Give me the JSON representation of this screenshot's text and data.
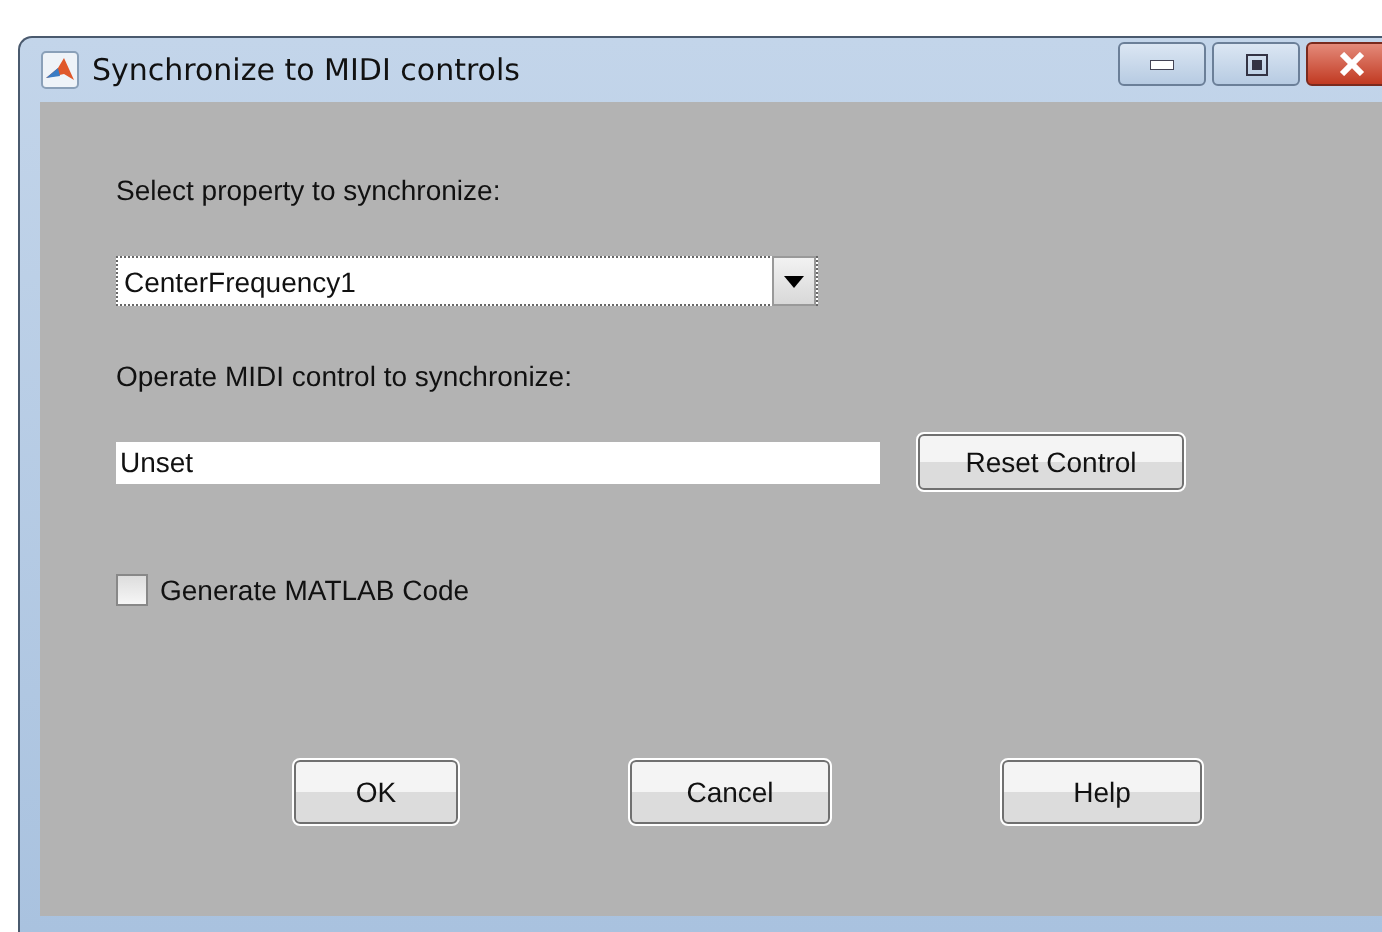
{
  "window": {
    "title": "Synchronize to MIDI controls"
  },
  "property_label": "Select property to synchronize:",
  "property_dropdown": {
    "value": "CenterFrequency1"
  },
  "control_label": "Operate MIDI control to synchronize:",
  "control_field": {
    "value": "Unset"
  },
  "reset_button": "Reset Control",
  "generate_code": {
    "label": "Generate MATLAB Code",
    "checked": false
  },
  "buttons": [
    "OK",
    "Cancel",
    "Help"
  ]
}
